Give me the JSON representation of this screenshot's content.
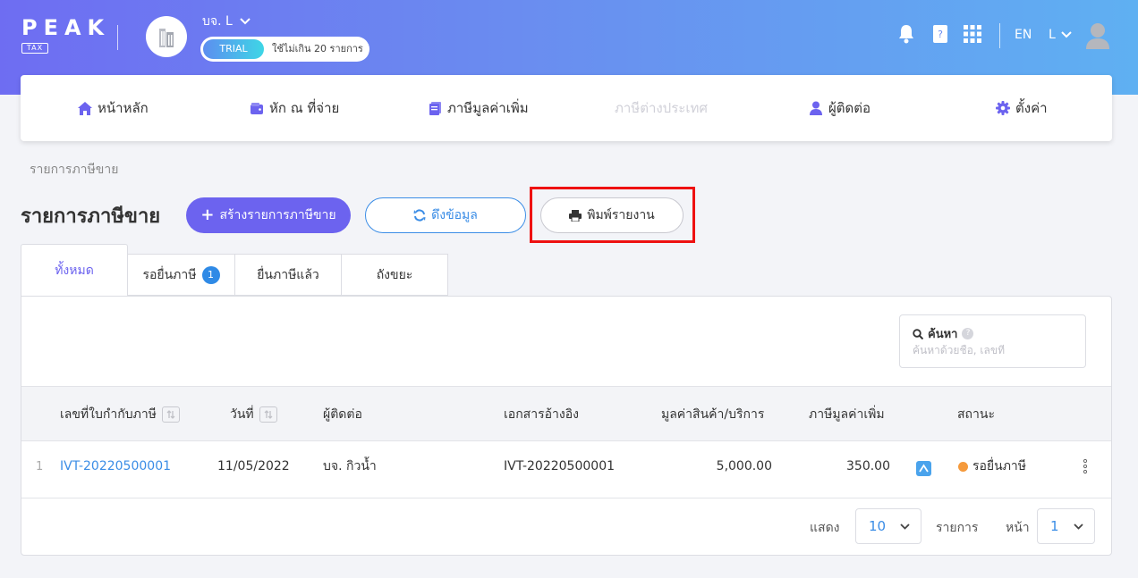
{
  "header": {
    "logo_text": "PEAK",
    "logo_tag": "TAX",
    "company_name": "บจ. L",
    "trial_label": "TRIAL",
    "trial_note": "ใช้ไม่เกิน 20 รายการ",
    "language": "EN",
    "user_initial": "L"
  },
  "nav": {
    "items": [
      {
        "label": "หน้าหลัก",
        "icon": "home-icon"
      },
      {
        "label": "หัก ณ ที่จ่าย",
        "icon": "wallet-icon"
      },
      {
        "label": "ภาษีมูลค่าเพิ่ม",
        "icon": "document-icon"
      },
      {
        "label": "ภาษีต่างประเทศ",
        "icon": "",
        "disabled": true
      },
      {
        "label": "ผู้ติดต่อ",
        "icon": "user-icon"
      },
      {
        "label": "ตั้งค่า",
        "icon": "gear-icon"
      }
    ]
  },
  "breadcrumb": "รายการภาษีขาย",
  "page_title": "รายการภาษีขาย",
  "actions": {
    "create_label": "สร้างรายการภาษีขาย",
    "fetch_label": "ดึงข้อมูล",
    "print_label": "พิมพ์รายงาน"
  },
  "tabs": [
    {
      "label": "ทั้งหมด",
      "active": true
    },
    {
      "label": "รอยื่นภาษี",
      "badge": "1"
    },
    {
      "label": "ยื่นภาษีแล้ว"
    },
    {
      "label": "ถังขยะ"
    }
  ],
  "search": {
    "label": "ค้นหา",
    "placeholder": "ค้นหาด้วยชื่อ, เลขที่",
    "value": ""
  },
  "table": {
    "columns": [
      "เลขที่ใบกำกับภาษี",
      "วันที่",
      "ผู้ติดต่อ",
      "เอกสารอ้างอิง",
      "มูลค่าสินค้า/บริการ",
      "ภาษีมูลค่าเพิ่ม",
      "สถานะ"
    ],
    "rows": [
      {
        "index": "1",
        "invoice_no": "IVT-20220500001",
        "date": "11/05/2022",
        "contact": "บจ. กิวน้ำ",
        "reference": "IVT-20220500001",
        "amount": "5,000.00",
        "vat": "350.00",
        "status": "รอยื่นภาษี"
      }
    ]
  },
  "pagination": {
    "show_label": "แสดง",
    "page_size": "10",
    "items_label": "รายการ",
    "page_label": "หน้า",
    "page": "1"
  },
  "colors": {
    "primary": "#6c63ef",
    "link": "#3b8de6",
    "highlight": "#ee1111",
    "status_pending": "#f59a3c"
  }
}
